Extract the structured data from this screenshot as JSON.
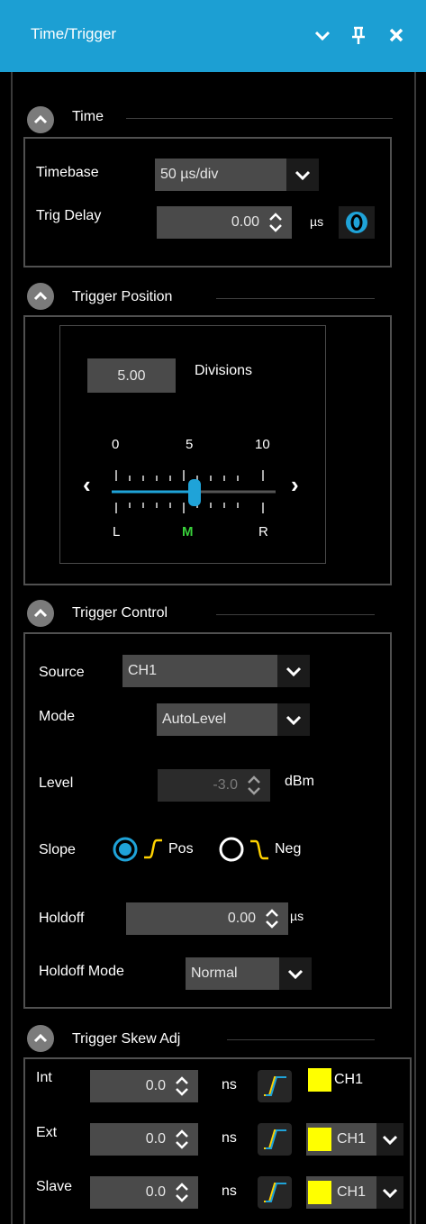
{
  "window": {
    "title": "Time/Trigger"
  },
  "icons": {
    "collapse": "chevron-down-icon",
    "pin": "pin-icon",
    "close": "close-icon"
  },
  "colors": {
    "titlebar": "#1c9fd3",
    "accent": "#1fa3d8",
    "marker_label": "#39d13b",
    "swatch": "#ffff00"
  },
  "time": {
    "title": "Time",
    "timebase_label": "Timebase",
    "timebase_value": "50  µs/div",
    "trig_delay_label": "Trig Delay",
    "trig_delay_value": "0.00",
    "trig_delay_unit": "µs"
  },
  "trigger_position": {
    "title": "Trigger Position",
    "divisions_value": "5.00",
    "divisions_label": "Divisions",
    "scale_ticks": [
      "0",
      "5",
      "10"
    ],
    "scale_markers": [
      "L",
      "M",
      "R"
    ],
    "slider_fraction": 0.5,
    "left_arrow": "‹",
    "right_arrow": "›"
  },
  "trigger_control": {
    "title": "Trigger Control",
    "source_label": "Source",
    "source_value": "CH1",
    "mode_label": "Mode",
    "mode_value": "AutoLevel",
    "level_label": "Level",
    "level_value": "-3.0",
    "level_unit": "dBm",
    "slope_label": "Slope",
    "slope_pos": "Pos",
    "slope_neg": "Neg",
    "slope_selected": "Pos",
    "holdoff_label": "Holdoff",
    "holdoff_value": "0.00",
    "holdoff_unit": "µs",
    "holdoff_mode_label": "Holdoff Mode",
    "holdoff_mode_value": "Normal"
  },
  "trigger_skew": {
    "title": "Trigger Skew Adj",
    "rows": [
      {
        "label": "Int",
        "value": "0.0",
        "unit": "ns",
        "channel": "CH1",
        "has_dropdown": false
      },
      {
        "label": "Ext",
        "value": "0.0",
        "unit": "ns",
        "channel": "CH1",
        "has_dropdown": true
      },
      {
        "label": "Slave",
        "value": "0.0",
        "unit": "ns",
        "channel": "CH1",
        "has_dropdown": true
      }
    ]
  }
}
